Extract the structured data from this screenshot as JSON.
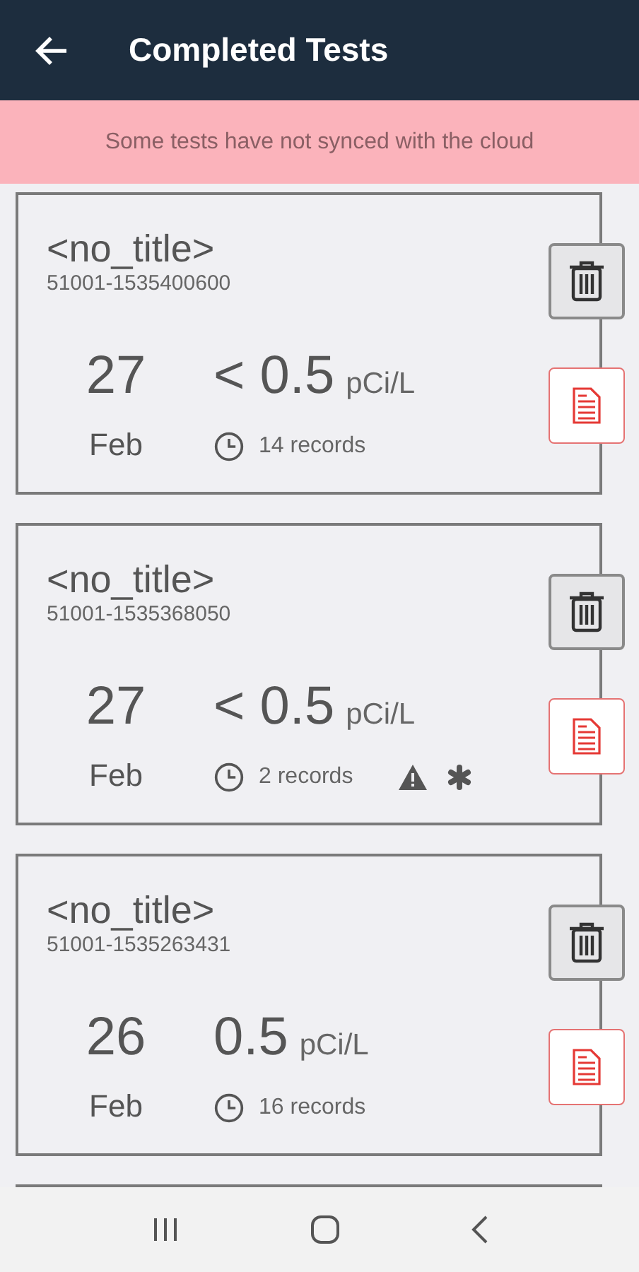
{
  "app_bar": {
    "title": "Completed Tests"
  },
  "banner": {
    "text": "Some tests have not synced with the cloud"
  },
  "tests": [
    {
      "title": "<no_title>",
      "id": "51001-1535400600",
      "day": "27",
      "month": "Feb",
      "value": "< 0.5",
      "unit": "pCi/L",
      "records": "14 records",
      "warning": false,
      "unsynced": false
    },
    {
      "title": "<no_title>",
      "id": "51001-1535368050",
      "day": "27",
      "month": "Feb",
      "value": "< 0.5",
      "unit": "pCi/L",
      "records": "2 records",
      "warning": true,
      "unsynced": true
    },
    {
      "title": "<no_title>",
      "id": "51001-1535263431",
      "day": "26",
      "month": "Feb",
      "value": "0.5",
      "unit": "pCi/L",
      "records": "16 records",
      "warning": false,
      "unsynced": false
    }
  ]
}
